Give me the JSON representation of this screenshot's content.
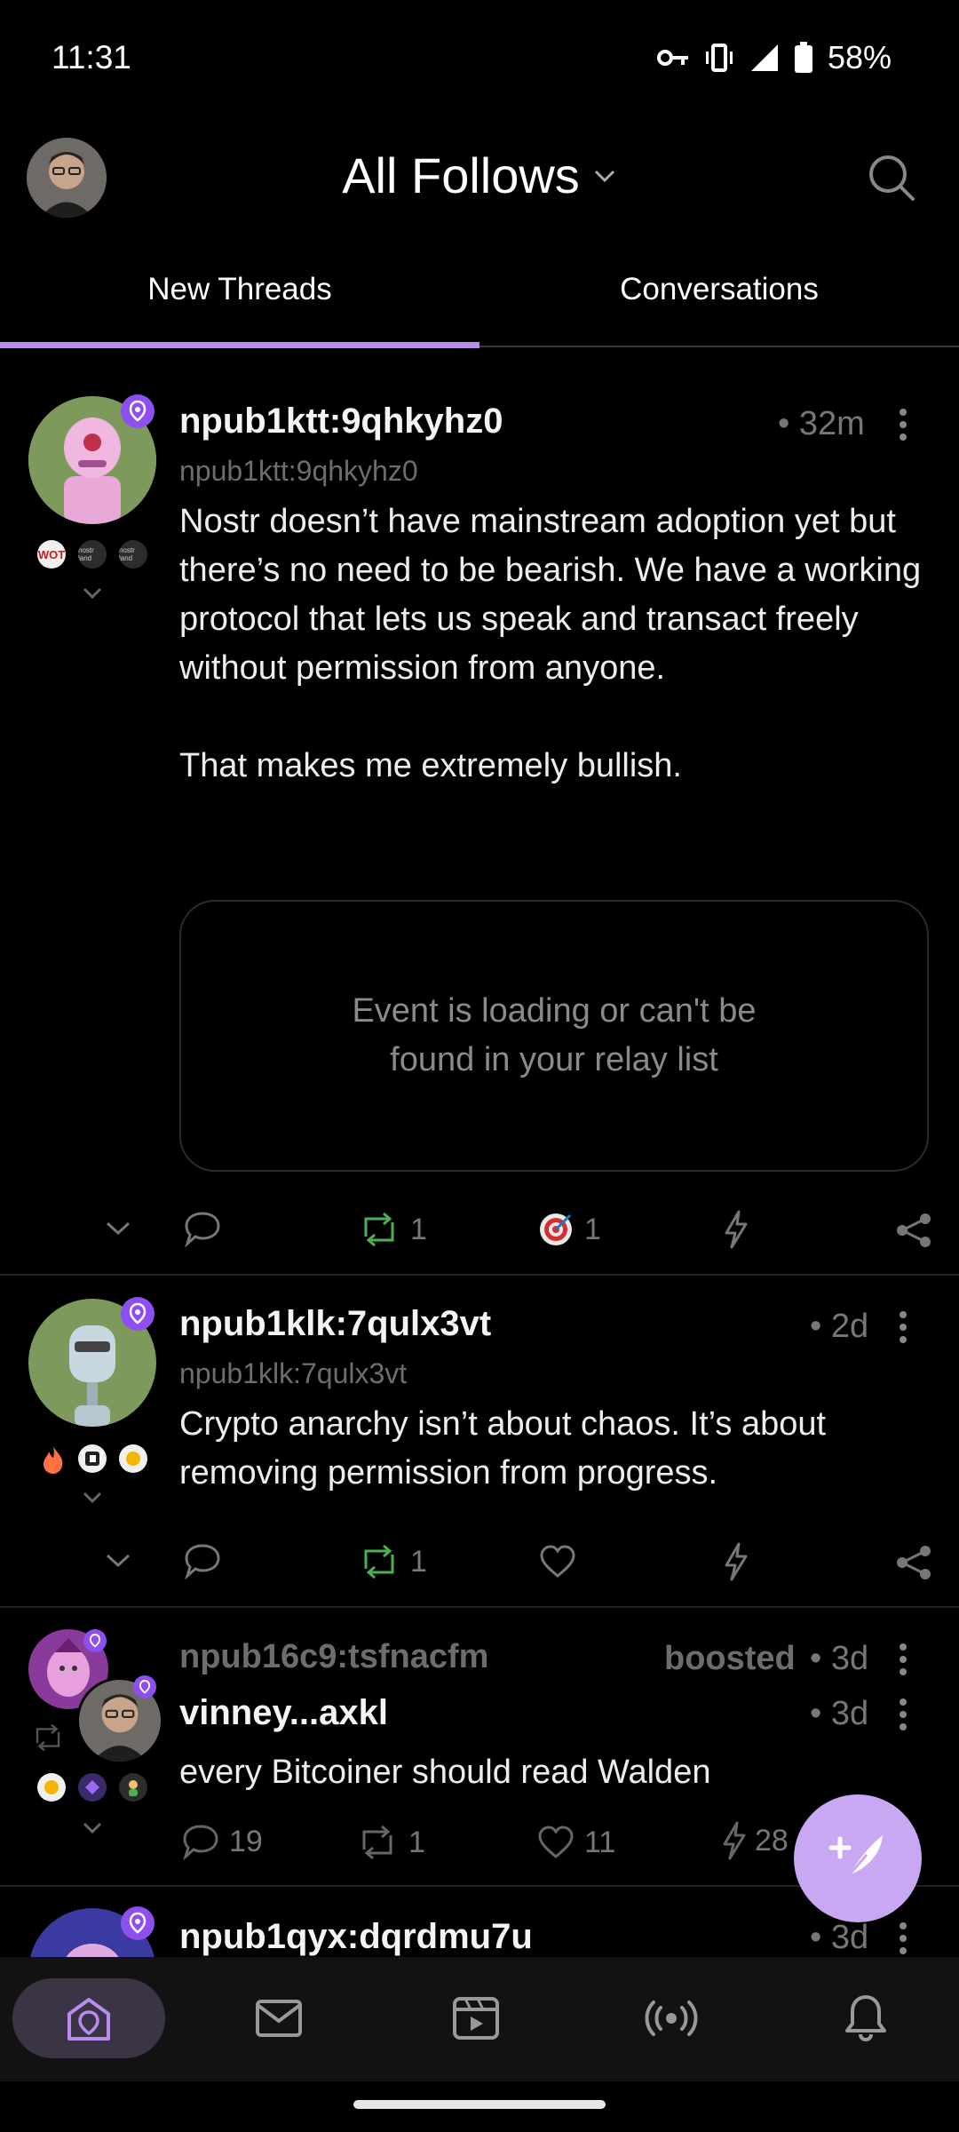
{
  "status_bar": {
    "time": "11:31",
    "battery": "58%"
  },
  "header": {
    "title": "All Follows"
  },
  "tabs": [
    {
      "label": "New Threads",
      "active": true
    },
    {
      "label": "Conversations",
      "active": false
    }
  ],
  "posts": [
    {
      "author": "npub1ktt:9qhkyhz0",
      "handle": "npub1ktt:9qhkyhz0",
      "time": "• 32m",
      "text": "Nostr doesn’t have mainstream adoption yet but there’s no need to be bearish. We have a working protocol that lets us speak and transact freely without permission from anyone.\n\nThat makes me extremely bullish.",
      "embedded_message": "Event is loading or can't be found in your relay list",
      "badges": [
        "WOT",
        "nostr land",
        "nostr land"
      ],
      "repost_count": "1",
      "reaction_count": "1"
    },
    {
      "author": "npub1klk:7qulx3vt",
      "handle": "npub1klk:7qulx3vt",
      "time": "• 2d",
      "text": "Crypto anarchy isn’t about chaos. It’s about removing permission from progress.",
      "repost_count": "1"
    },
    {
      "booster": "npub16c9:tsfnacfm",
      "boosted_label": "boosted",
      "boost_time": "• 3d",
      "author": "vinney...axkl",
      "time": "• 3d",
      "text": "every Bitcoiner should read Walden",
      "reply_count": "19",
      "repost_count": "1",
      "like_count": "11",
      "zap_count": "28"
    },
    {
      "author": "npub1qyx:dqrdmu7u",
      "time": "• 3d"
    }
  ],
  "colors": {
    "accent": "#b98cf0",
    "badge": "#8e4ff0",
    "repost_green": "#4caf50",
    "fab": "#c8a8f2"
  },
  "nav": [
    "home-icon",
    "mail-icon",
    "video-icon",
    "broadcast-icon",
    "bell-icon"
  ]
}
